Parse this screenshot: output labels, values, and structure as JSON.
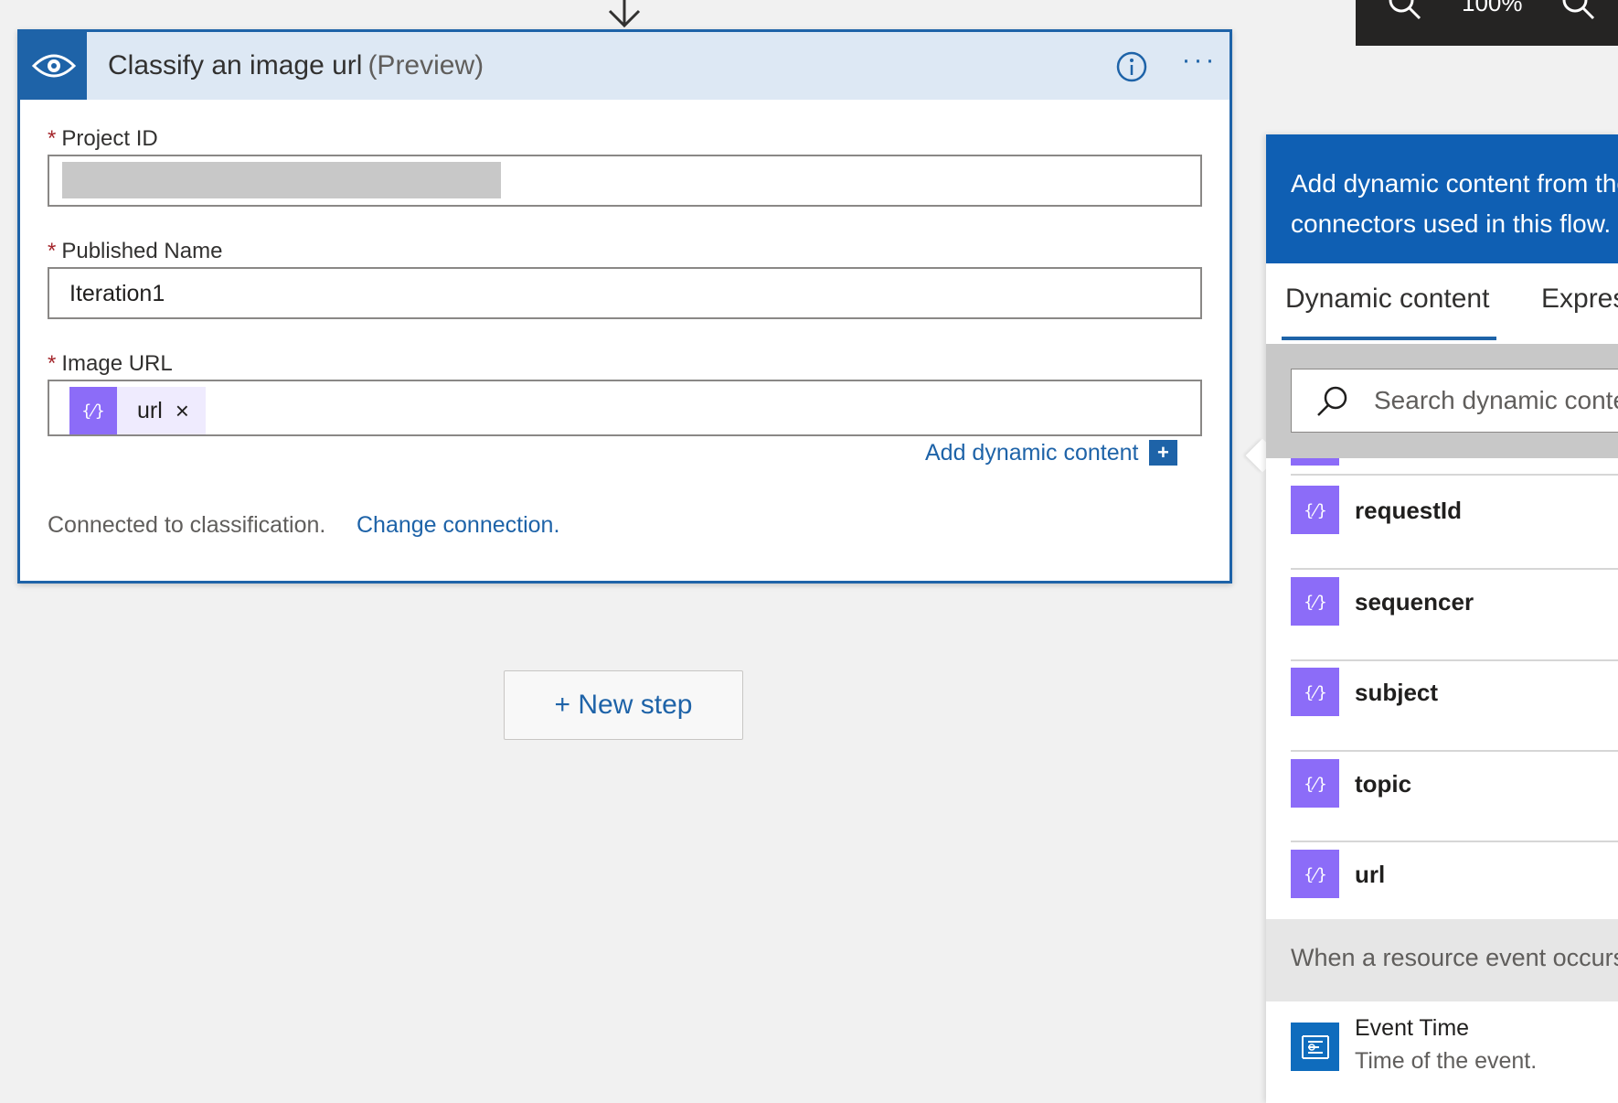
{
  "toolbar": {
    "zoom_label": "100%"
  },
  "card": {
    "title": "Classify an image url",
    "title_suffix": "(Preview)",
    "required_mark": "*",
    "fields": {
      "project_id": {
        "label": "Project ID"
      },
      "published_name": {
        "label": "Published Name",
        "value": "Iteration1"
      },
      "image_url": {
        "label": "Image URL",
        "token": "url",
        "token_remove": "×"
      }
    },
    "add_dynamic_content": "Add dynamic content",
    "add_dynamic_plus": "+",
    "connection_text": "Connected to classification.",
    "change_connection": "Change connection."
  },
  "new_step": {
    "label": "+ New step"
  },
  "dynamic_panel": {
    "banner": "Add dynamic content from the apps and connectors used in this flow.",
    "tabs": [
      "Dynamic content",
      "Expression"
    ],
    "search_placeholder": "Search dynamic content",
    "items": [
      "requestId",
      "sequencer",
      "subject",
      "topic",
      "url"
    ],
    "section_label": "When a resource event occurs",
    "event_item": {
      "label": "Event Time",
      "description": "Time of the event."
    }
  },
  "colors": {
    "accent": "#1e63a8",
    "token_purple": "#8c6cf8",
    "header_bg": "#dde8f4",
    "required": "#a4262c"
  }
}
